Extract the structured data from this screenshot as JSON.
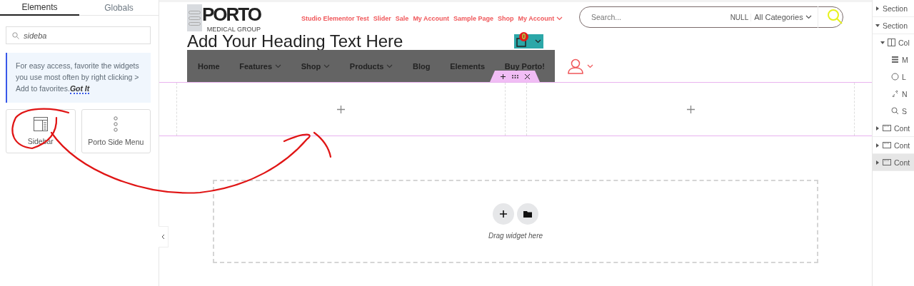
{
  "panel_tabs": [
    {
      "label": "Elements",
      "selected": true
    },
    {
      "label": "Globals",
      "selected": false
    }
  ],
  "widget_search": {
    "value": "sideba"
  },
  "tip": {
    "text": "For easy access, favorite the widgets you use most often by right clicking > Add to favorites.",
    "link": "Got It"
  },
  "widgets": [
    {
      "label": "Sidebar",
      "kind": "sidebar"
    },
    {
      "label": "Porto Side Menu",
      "kind": "dots"
    }
  ],
  "site": {
    "logo_text": "PORTO",
    "logo_subtitle": "MEDICAL GROUP",
    "top_menu": [
      {
        "label": "Studio Elementor Test",
        "dropdown": false
      },
      {
        "label": "Slider",
        "dropdown": false
      },
      {
        "label": "Sale",
        "dropdown": false
      },
      {
        "label": "My Account",
        "dropdown": false
      },
      {
        "label": "Sample Page",
        "dropdown": false
      },
      {
        "label": "Shop",
        "dropdown": false
      },
      {
        "label": "My Account",
        "dropdown": true
      }
    ],
    "search": {
      "placeholder": "Search...",
      "null_label": "NULL",
      "category": "All Categories"
    },
    "heading": "Add Your Heading Text Here",
    "cart_count": "0",
    "main_menu": [
      {
        "label": "Home",
        "dropdown": false
      },
      {
        "label": "Features",
        "dropdown": true
      },
      {
        "label": "Shop",
        "dropdown": true
      },
      {
        "label": "Products",
        "dropdown": true
      },
      {
        "label": "Blog",
        "dropdown": false
      },
      {
        "label": "Elements",
        "dropdown": false
      },
      {
        "label": "Buy Porto!",
        "dropdown": false
      }
    ]
  },
  "drop_zone": {
    "hint": "Drag widget here"
  },
  "navigator": [
    {
      "label": "Section",
      "kind": "section",
      "expanded": false,
      "selected": false
    },
    {
      "label": "Section",
      "kind": "section",
      "expanded": true,
      "selected": false,
      "children": [
        {
          "label": "Col",
          "kind": "column",
          "expanded": true,
          "selected": false,
          "children": [
            {
              "label": "M",
              "kind": "menu",
              "selected": false
            },
            {
              "label": "L",
              "kind": "circle",
              "selected": false
            },
            {
              "label": "N",
              "kind": "link",
              "selected": false
            },
            {
              "label": "S",
              "kind": "search",
              "selected": false
            }
          ]
        }
      ]
    },
    {
      "label": "Cont",
      "kind": "container",
      "expanded": false,
      "selected": false
    },
    {
      "label": "Cont",
      "kind": "container",
      "expanded": false,
      "selected": false
    },
    {
      "label": "Cont",
      "kind": "container",
      "expanded": false,
      "selected": true
    }
  ]
}
